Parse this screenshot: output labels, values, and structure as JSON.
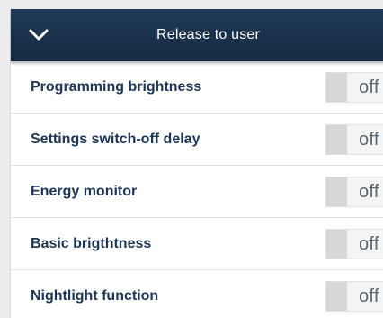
{
  "header": {
    "title": "Release to user",
    "collapse_icon": "chevron-down-icon"
  },
  "settings": [
    {
      "label": "Programming brightness",
      "state": "off"
    },
    {
      "label": "Settings switch-off delay",
      "state": "off"
    },
    {
      "label": "Energy monitor",
      "state": "off"
    },
    {
      "label": "Basic brigthtness",
      "state": "off"
    },
    {
      "label": "Nightlight function",
      "state": "off"
    }
  ],
  "colors": {
    "header_bg": "#1b3350",
    "label_text": "#1e3656",
    "toggle_knob": "#d7d7d7"
  }
}
